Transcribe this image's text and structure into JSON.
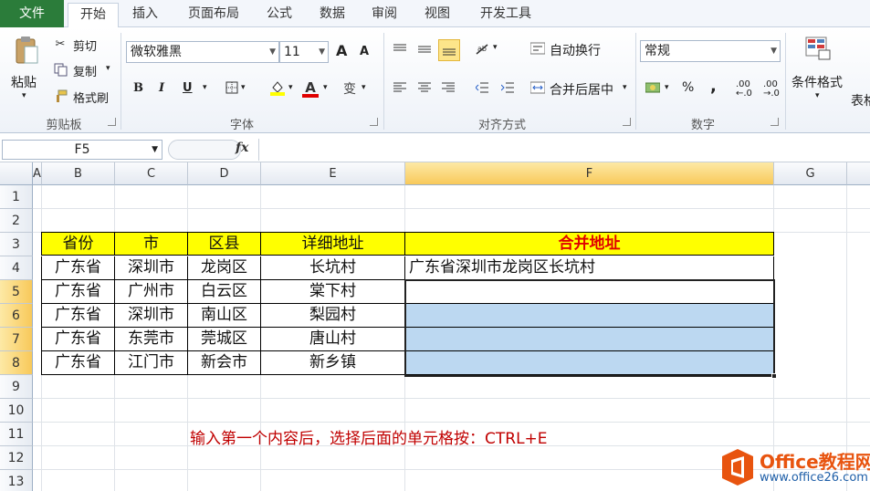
{
  "ribbon_tabs": [
    "文件",
    "开始",
    "插入",
    "页面布局",
    "公式",
    "数据",
    "审阅",
    "视图",
    "开发工具"
  ],
  "clipboard": {
    "paste": "粘贴",
    "cut": "剪切",
    "copy": "复制",
    "format_painter": "格式刷",
    "group": "剪贴板"
  },
  "font": {
    "name": "微软雅黑",
    "size": "11",
    "grow": "A",
    "shrink": "A",
    "bold": "B",
    "italic": "I",
    "underline": "U",
    "phonetic": "变",
    "color_letter": "A",
    "group": "字体"
  },
  "alignment": {
    "wrap": "自动换行",
    "merge": "合并后居中",
    "group": "对齐方式"
  },
  "number": {
    "format": "常规",
    "percent": "%",
    "comma": ",",
    "inc_decimal": ".00 ←.0",
    "dec_decimal": ".00 →.0",
    "group": "数字"
  },
  "styles": {
    "conditional": "条件格式",
    "table_partial": "表格"
  },
  "formula_bar": {
    "name_box": "F5",
    "fx": "fx",
    "value": ""
  },
  "columns": [
    "A",
    "B",
    "C",
    "D",
    "E",
    "F",
    "G"
  ],
  "selected_column": "F",
  "rows": [
    "1",
    "2",
    "3",
    "4",
    "5",
    "6",
    "7",
    "8",
    "9",
    "10",
    "11",
    "12",
    "13"
  ],
  "selected_rows": [
    "5",
    "6",
    "7",
    "8"
  ],
  "table": {
    "headers": [
      "省份",
      "市",
      "区县",
      "详细地址",
      "合并地址"
    ],
    "rows": [
      [
        "广东省",
        "深圳市",
        "龙岗区",
        "长坑村",
        "广东省深圳市龙岗区长坑村"
      ],
      [
        "广东省",
        "广州市",
        "白云区",
        "棠下村",
        ""
      ],
      [
        "广东省",
        "深圳市",
        "南山区",
        "梨园村",
        ""
      ],
      [
        "广东省",
        "东莞市",
        "莞城区",
        "唐山村",
        ""
      ],
      [
        "广东省",
        "江门市",
        "新会市",
        "新乡镇",
        ""
      ]
    ]
  },
  "note": "输入第一个内容后，选择后面的单元格按：CTRL+E",
  "watermark": {
    "main": "Office教程网",
    "url": "www.office26.com"
  },
  "colors": {
    "file_tab": "#2b7c3a",
    "header_fill": "#ffff00",
    "header_red": "#e00000",
    "selection_fill": "#bcd8f1",
    "note": "#c00000",
    "logo_orange": "#e8540f"
  }
}
